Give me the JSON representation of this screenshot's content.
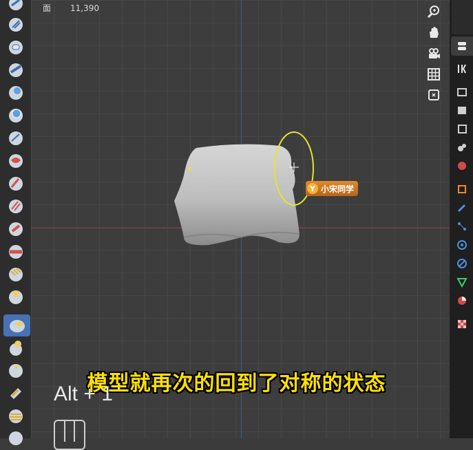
{
  "viewport": {
    "stats_label": "面",
    "stats_value": "11,390"
  },
  "overlay": {
    "subtitle": "模型就再次的回到了对称的状态",
    "key_hint": "Alt + 1"
  },
  "watermark": {
    "badge": "Y",
    "name": "小宋同学"
  },
  "tools": [
    "draw-brush-icon",
    "draw-sharp-brush-icon",
    "clay-brush-icon",
    "clay-strips-brush-icon",
    "clay-thumb-brush-icon",
    "layer-brush-icon",
    "inflate-brush-icon",
    "blob-brush-icon",
    "crease-brush-icon",
    "smooth-brush-icon",
    "flatten-brush-icon",
    "fill-brush-icon",
    "scrape-brush-icon",
    "multiplane-scrape-brush-icon",
    "pinch-brush-icon",
    "grab-brush-icon",
    "snake-hook-brush-icon",
    "thumb-brush-icon",
    "pose-brush-icon",
    "nudge-brush-icon"
  ],
  "active_tool": "grab-brush-icon",
  "nav_buttons": [
    "zoom-icon",
    "hand-pan-icon",
    "camera-icon",
    "grid-ortho-icon"
  ],
  "property_tabs": [
    "tool-icon",
    "render-icon",
    "output-icon",
    "view-layer-icon",
    "scene-icon",
    "world-icon",
    "object-icon",
    "modifier-icon",
    "particles-icon",
    "physics-icon",
    "constraints-icon",
    "data-icon",
    "material-icon",
    "texture-icon"
  ],
  "colors": {
    "accent": "#4772b3",
    "subtitle": "#ffe100",
    "brush_circle": "#e4e430"
  }
}
